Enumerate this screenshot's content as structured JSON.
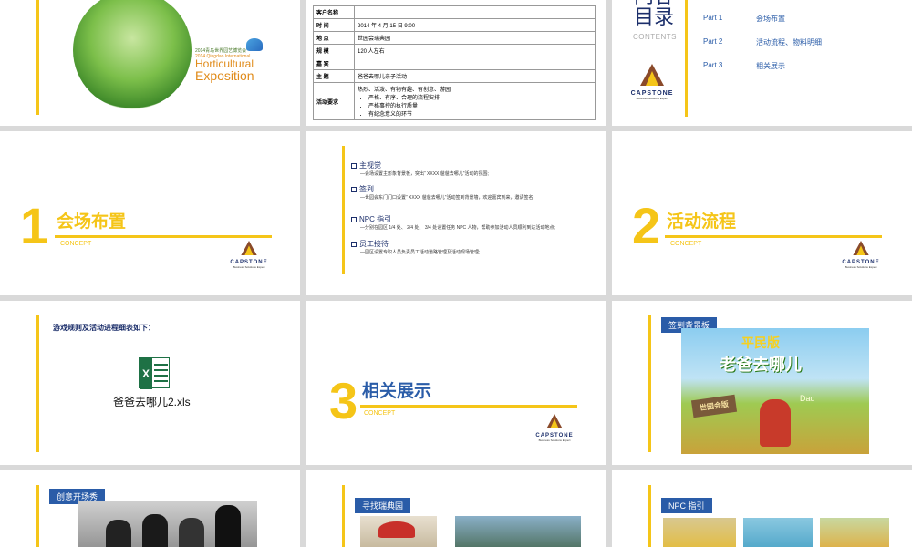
{
  "slide1": {
    "year_cn": "2014青岛世界园艺博览会",
    "year_en": "2014 Qingdao International",
    "hort_line1": "Horticultural",
    "hort_line2": "Exposition"
  },
  "slide2": {
    "rows": [
      {
        "key": "客户名称",
        "value": ""
      },
      {
        "key": "时 间",
        "value": "2014 年 4 月 15 日 9:00"
      },
      {
        "key": "地 点",
        "value": "世园会瑞典园"
      },
      {
        "key": "规 模",
        "value": "120 人左右"
      },
      {
        "key": "嘉 宾",
        "value": ""
      },
      {
        "key": "主 题",
        "value": "爸爸去哪儿亲子活动"
      }
    ],
    "req_key": "活动要求",
    "req_intro": "热烈、活泼、有物有趣、有创意、游园",
    "req_items": [
      "严格、有序、合理的流程安排",
      "严格事控的执行质量",
      "有纪念意义的环节"
    ]
  },
  "slide3": {
    "title_line1": "内容",
    "title_line2": "目录",
    "contents": "CONTENTS",
    "parts": [
      {
        "label": "Part 1",
        "text": "会场布置"
      },
      {
        "label": "Part 2",
        "text": "活动流程、物料明细"
      },
      {
        "label": "Part 3",
        "text": "相关展示"
      }
    ],
    "brand": "CAPSTONE",
    "brand_sub": "Business Solutions Expert"
  },
  "slide4": {
    "num": "1",
    "title": "会场布置",
    "concept": "CONCEPT"
  },
  "slide5": {
    "items": [
      {
        "head": "主视觉",
        "desc": "—会场设置主形象背景板，突出“ XXXX 爸爸去哪儿”活动的氛围;"
      },
      {
        "head": "签到",
        "desc": "—世园会东门门口设置“ XXXX 爸爸去哪儿”活动签到背景墙，欢迎嘉宾到来，邀请签名;"
      },
      {
        "head": "NPC 指引",
        "desc": "—分别在园区 1/4 处、 2/4 处、 3/4 处设置任务 NPC 人物，帮助参加活动人员顺利到达活动地点;"
      },
      {
        "head": "员工接待",
        "desc": "—园区设置专职人员负责员工活动道路管理及活动现场管理;"
      }
    ]
  },
  "slide6": {
    "num": "2",
    "title": "活动流程",
    "concept": "CONCEPT"
  },
  "slide7": {
    "heading": "游戏规则及活动进程细表如下：",
    "file": "爸爸去哪儿2.xls"
  },
  "slide8": {
    "num": "3",
    "title": "相关展示",
    "concept": "CONCEPT"
  },
  "slide9": {
    "tag": "签到背景板",
    "poster_title_1": "平民版",
    "poster_title_2": "老爸去哪儿",
    "sign": "世园会版",
    "dad": "Dad"
  },
  "slide10": {
    "tag": "创意开场秀"
  },
  "slide11": {
    "tag": "寻找瑞典园"
  },
  "slide12": {
    "tag": "NPC 指引"
  }
}
